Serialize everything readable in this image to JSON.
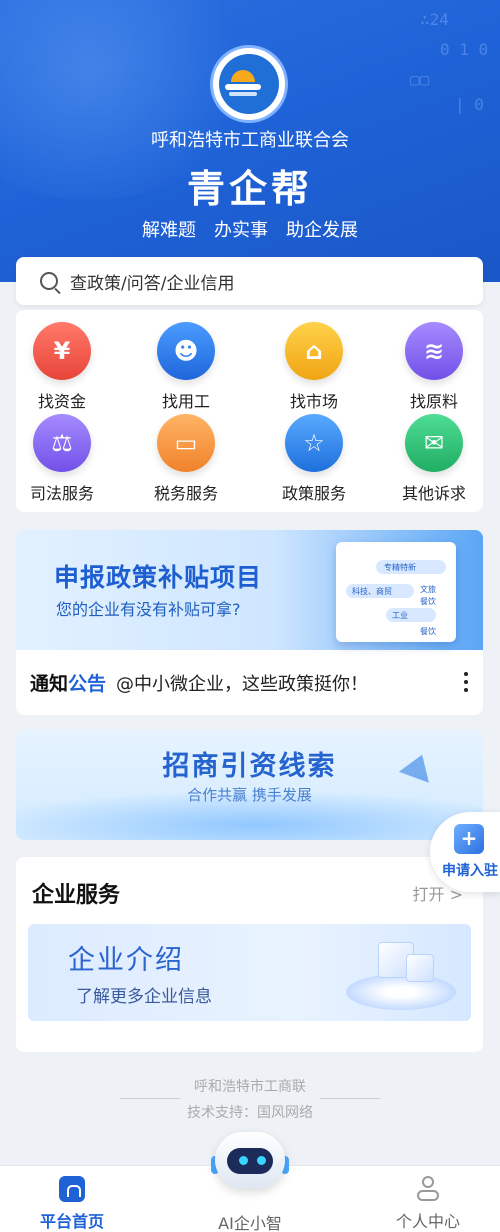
{
  "header": {
    "org_name": "呼和浩特市工商业联合会",
    "app_title": "青企帮",
    "slogans": [
      "解难题",
      "办实事",
      "助企发展"
    ]
  },
  "search": {
    "placeholder": "查政策/问答/企业信用"
  },
  "services": [
    {
      "label": "找资金",
      "icon": "money-bag-icon",
      "color": "#f05a4a"
    },
    {
      "label": "找用工",
      "icon": "worker-icon",
      "color": "#2f7fe8"
    },
    {
      "label": "找市场",
      "icon": "market-house-icon",
      "color": "#f5b51c"
    },
    {
      "label": "找原料",
      "icon": "materials-hand-icon",
      "color": "#8a6cf0"
    },
    {
      "label": "司法服务",
      "icon": "scales-icon",
      "color": "#8a6cf0"
    },
    {
      "label": "税务服务",
      "icon": "tax-card-icon",
      "color": "#f39a3a"
    },
    {
      "label": "政策服务",
      "icon": "policy-document-icon",
      "color": "#2f8ae8"
    },
    {
      "label": "其他诉求",
      "icon": "mail-icon",
      "color": "#2fc07a"
    }
  ],
  "banner_policy": {
    "title": "申报政策补贴项目",
    "subtitle": "您的企业有没有补贴可拿?",
    "tags": [
      "专精特新",
      "科技、商贸",
      "工业",
      "文旅",
      "餐饮",
      "餐饮"
    ]
  },
  "notice": {
    "label_a": "通知",
    "label_b": "公告",
    "text": "@中小微企业，这些政策挺你！"
  },
  "banner_investment": {
    "title": "招商引资线索",
    "subtitle": "合作共赢   携手发展"
  },
  "apply_float": {
    "label": "申请入驻",
    "icon": "plus-building-icon"
  },
  "enterprise_services": {
    "heading": "企业服务",
    "open_label": "打开 >",
    "banner_title": "企业介绍",
    "banner_subtitle": "了解更多企业信息"
  },
  "footer": {
    "line1": "呼和浩特市工商联",
    "line2": "技术支持：国风网络"
  },
  "bottom_nav": [
    {
      "label": "平台首页",
      "icon": "home-icon",
      "active": true
    },
    {
      "label": "AI企小智",
      "icon": "robot-icon",
      "active": false
    },
    {
      "label": "个人中心",
      "icon": "user-icon",
      "active": false
    }
  ],
  "colors": {
    "primary": "#1f62d6",
    "background": "#eef2f7"
  }
}
